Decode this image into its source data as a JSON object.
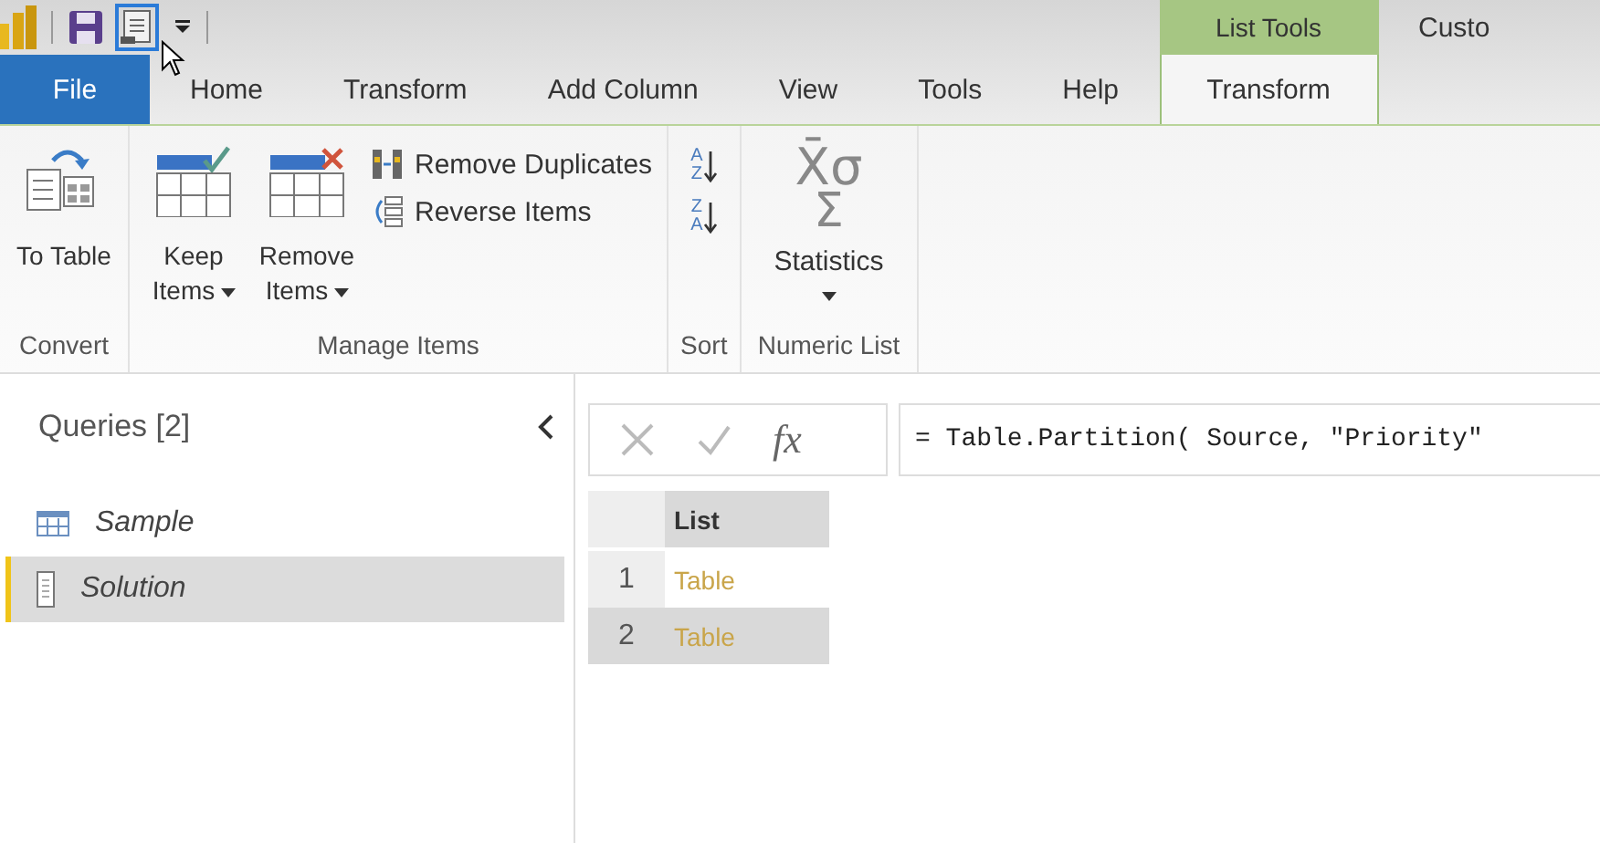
{
  "tabs": [
    {
      "label": "File",
      "kind": "file",
      "selected": false
    },
    {
      "label": "Home",
      "kind": "normal",
      "selected": false
    },
    {
      "label": "Transform",
      "kind": "normal",
      "selected": false
    },
    {
      "label": "Add Column",
      "kind": "normal",
      "selected": false
    },
    {
      "label": "View",
      "kind": "normal",
      "selected": false
    },
    {
      "label": "Tools",
      "kind": "normal",
      "selected": false
    },
    {
      "label": "Help",
      "kind": "normal",
      "selected": false
    },
    {
      "label": "Transform",
      "kind": "contextual",
      "group": "List Tools",
      "selected": true
    },
    {
      "kind": "contextual-next",
      "group": "Custo",
      "selected": false
    }
  ],
  "ribbon_groups": [
    {
      "label": "Convert",
      "items": [
        {
          "kind": "large",
          "label": "To Table",
          "dropdown": false
        }
      ]
    },
    {
      "label": "Manage Items",
      "items": [
        {
          "kind": "large",
          "label": "Keep Items",
          "dropdown": true
        },
        {
          "kind": "large",
          "label": "Remove Items",
          "dropdown": true
        },
        {
          "kind": "small-stack",
          "buttons": [
            "Remove Duplicates",
            "Reverse Items"
          ]
        }
      ]
    },
    {
      "label": "Sort",
      "items": [
        {
          "kind": "sort-stack",
          "buttons": [
            {
              "upper": "A",
              "lower": "Z"
            },
            {
              "upper": "Z",
              "lower": "A"
            }
          ]
        }
      ]
    },
    {
      "label": "Numeric List",
      "items": [
        {
          "kind": "stats",
          "symbol": "X̄σ",
          "symbol2": "Σ",
          "label": "Statistics",
          "dropdown": true
        }
      ]
    }
  ],
  "queries": {
    "title": "Queries [2]",
    "items": [
      {
        "name": "Sample",
        "kind": "table",
        "selected": false
      },
      {
        "name": "Solution",
        "kind": "list",
        "selected": true
      }
    ]
  },
  "formula_bar": {
    "fx": "fx",
    "formula": "= Table.Partition( Source, \"Priority\""
  },
  "table": {
    "columns": [
      "List"
    ],
    "rows": [
      {
        "index": "1",
        "cells": [
          "Table"
        ],
        "selected": false
      },
      {
        "index": "2",
        "cells": [
          "Table"
        ],
        "selected": true
      }
    ]
  }
}
